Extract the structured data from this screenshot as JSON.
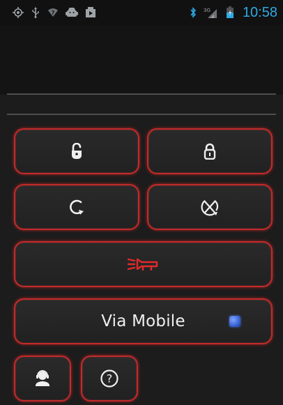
{
  "status_bar": {
    "left_icons": [
      "gps-icon",
      "usb-icon",
      "wifi-question-icon",
      "android-debug-icon",
      "media-play-icon"
    ],
    "right_icons": [
      "bluetooth-icon",
      "signal-3g-icon",
      "battery-icon"
    ],
    "clock": "10:58"
  },
  "controls": {
    "unlock": {
      "icon": "unlock-icon"
    },
    "lock": {
      "icon": "lock-icon"
    },
    "remote_start": {
      "icon": "remote-start-icon"
    },
    "engine_stop": {
      "icon": "engine-stop-icon"
    },
    "horn": {
      "icon": "horn-icon",
      "color": "#e22a2a"
    },
    "via_mobile": {
      "label": "Via Mobile",
      "checked": true,
      "check_color": "#3d68d8"
    },
    "contact": {
      "icon": "support-agent-icon"
    },
    "help": {
      "icon": "help-icon"
    }
  },
  "colors": {
    "accent_border": "#c22a2a",
    "clock_blue": "#2fa9e3",
    "status_icon_gray": "#9fa3a7"
  }
}
